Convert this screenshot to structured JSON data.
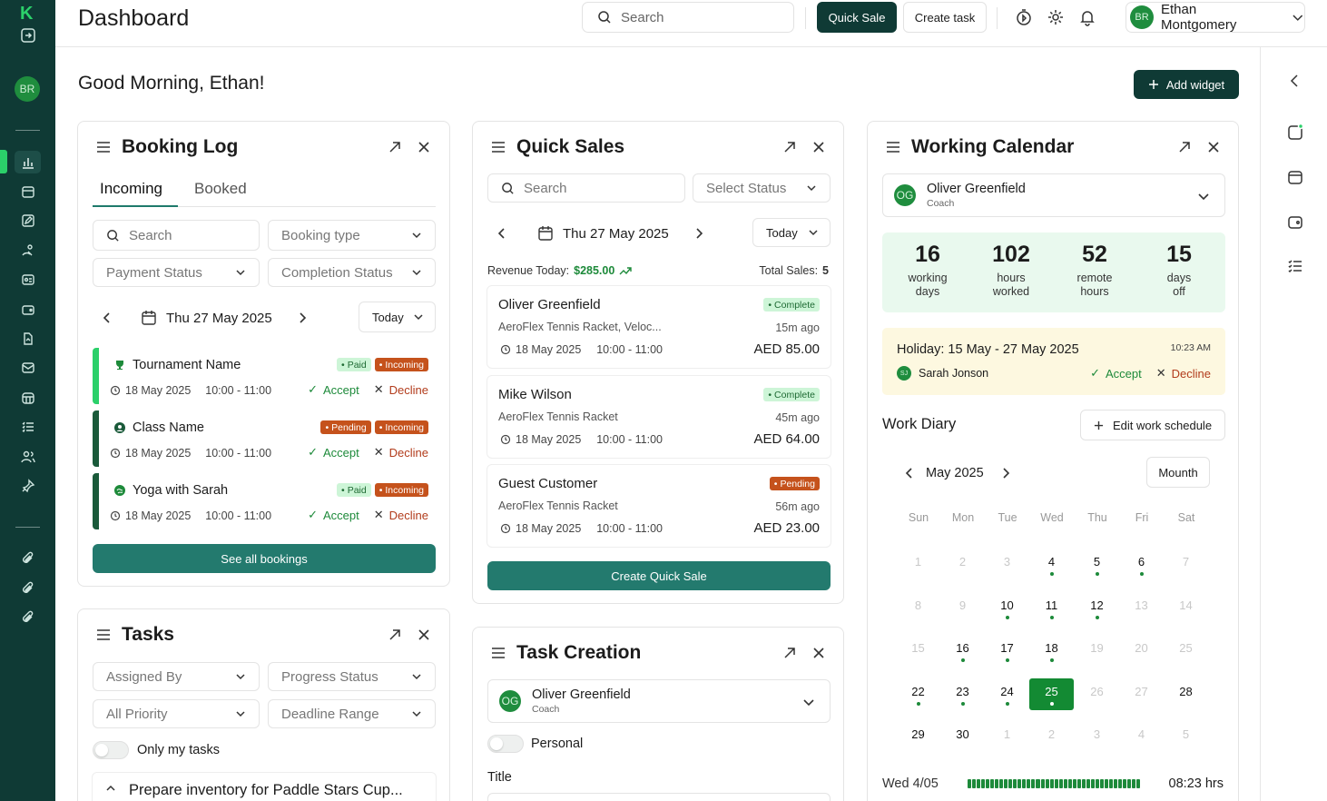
{
  "nav": {
    "logo": "K",
    "avatar": "BR"
  },
  "header": {
    "title": "Dashboard",
    "search_placeholder": "Search",
    "quick_sale": "Quick Sale",
    "create_task": "Create task",
    "user_initials": "BR",
    "user_name": "Ethan Montgomery"
  },
  "greeting": "Good Morning, Ethan!",
  "add_widget": "Add widget",
  "booking_log": {
    "title": "Booking Log",
    "tabs": [
      "Incoming",
      "Booked"
    ],
    "search": "Search",
    "booking_type": "Booking type",
    "payment_status": "Payment Status",
    "completion_status": "Completion Status",
    "date": "Thu 27 May 2025",
    "today": "Today",
    "accept": "Accept",
    "decline": "Decline",
    "items": [
      {
        "name": "Tournament Name",
        "date": "18 May 2025",
        "time": "10:00 - 11:00",
        "status": "Paid",
        "flow": "Incoming"
      },
      {
        "name": "Class Name",
        "date": "18 May 2025",
        "time": "10:00 - 11:00",
        "status": "Pending",
        "flow": "Incoming"
      },
      {
        "name": "Yoga with Sarah",
        "date": "18 May 2025",
        "time": "10:00 - 11:00",
        "status": "Paid",
        "flow": "Incoming"
      }
    ],
    "see_all": "See all bookings"
  },
  "tasks": {
    "title": "Tasks",
    "assigned_by": "Assigned By",
    "progress_status": "Progress Status",
    "all_priority": "All Priority",
    "deadline_range": "Deadline Range",
    "only_my_tasks": "Only my tasks",
    "first_task": "Prepare inventory for Paddle Stars Cup..."
  },
  "quick_sales": {
    "title": "Quick Sales",
    "search": "Search",
    "select_status": "Select Status",
    "date": "Thu 27 May 2025",
    "today": "Today",
    "revenue_label": "Revenue Today:",
    "revenue_value": "$285.00",
    "total_label": "Total Sales:",
    "total_value": "5",
    "items": [
      {
        "name": "Oliver Greenfield",
        "item": "AeroFlex Tennis Racket, Veloc...",
        "date": "18 May 2025",
        "time": "10:00 - 11:00",
        "status": "Complete",
        "ago": "15m ago",
        "amount": "AED 85.00"
      },
      {
        "name": "Mike Wilson",
        "item": "AeroFlex Tennis Racket",
        "date": "18 May 2025",
        "time": "10:00 - 11:00",
        "status": "Complete",
        "ago": "45m ago",
        "amount": "AED 64.00"
      },
      {
        "name": "Guest Customer",
        "item": "AeroFlex Tennis Racket",
        "date": "18 May 2025",
        "time": "10:00 - 11:00",
        "status": "Pending",
        "ago": "56m ago",
        "amount": "AED 23.00"
      }
    ],
    "create": "Create Quick Sale"
  },
  "task_creation": {
    "title": "Task Creation",
    "coach_initials": "OG",
    "coach_name": "Oliver Greenfield",
    "coach_role": "Coach",
    "personal": "Personal",
    "title_label": "Title"
  },
  "calendar": {
    "title": "Working Calendar",
    "coach_initials": "OG",
    "coach_name": "Oliver Greenfield",
    "coach_role": "Coach",
    "stats": [
      {
        "value": "16",
        "l1": "working",
        "l2": "days"
      },
      {
        "value": "102",
        "l1": "hours",
        "l2": "worked"
      },
      {
        "value": "52",
        "l1": "remote",
        "l2": "hours"
      },
      {
        "value": "15",
        "l1": "days",
        "l2": "off"
      }
    ],
    "holiday": "Holiday: 15 May - 27 May 2025",
    "holiday_time": "10:23 AM",
    "holiday_person_initials": "SJ",
    "holiday_person": "Sarah Jonson",
    "accept": "Accept",
    "decline": "Decline",
    "work_diary": "Work Diary",
    "edit_schedule": "Edit work schedule",
    "month": "May 2025",
    "view": "Mounth",
    "day_names": [
      "Sun",
      "Mon",
      "Tue",
      "Wed",
      "Thu",
      "Fri",
      "Sat"
    ],
    "weeks": [
      [
        [
          "1",
          0,
          0
        ],
        [
          "2",
          0,
          0
        ],
        [
          "3",
          0,
          0
        ],
        [
          "4",
          1,
          1
        ],
        [
          "5",
          1,
          1
        ],
        [
          "6",
          1,
          1
        ],
        [
          "7",
          0,
          0
        ]
      ],
      [
        [
          "8",
          0,
          0
        ],
        [
          "9",
          0,
          0
        ],
        [
          "10",
          1,
          1
        ],
        [
          "11",
          1,
          1
        ],
        [
          "12",
          1,
          1
        ],
        [
          "13",
          0,
          0
        ],
        [
          "14",
          0,
          0
        ]
      ],
      [
        [
          "15",
          0,
          0
        ],
        [
          "16",
          1,
          1
        ],
        [
          "17",
          1,
          1
        ],
        [
          "18",
          1,
          1
        ],
        [
          "19",
          0,
          0
        ],
        [
          "20",
          0,
          0
        ],
        [
          "25",
          0,
          0
        ]
      ],
      [
        [
          "22",
          1,
          1
        ],
        [
          "23",
          1,
          1
        ],
        [
          "24",
          1,
          1
        ],
        [
          "25",
          1,
          1
        ],
        [
          "26",
          0,
          0
        ],
        [
          "27",
          0,
          0
        ],
        [
          "28",
          1,
          0
        ]
      ],
      [
        [
          "29",
          1,
          0
        ],
        [
          "30",
          1,
          0
        ],
        [
          "1",
          0,
          0
        ],
        [
          "2",
          0,
          0
        ],
        [
          "3",
          0,
          0
        ],
        [
          "4",
          0,
          0
        ],
        [
          "5",
          0,
          0
        ]
      ]
    ],
    "selected_day": "25",
    "footer_day": "Wed 4/05",
    "footer_hours": "08:23 hrs"
  },
  "colors": {
    "sidebar": "#0f3a35",
    "accent": "#2bd06a",
    "teal": "#237a6e",
    "orange": "#c5521c"
  }
}
